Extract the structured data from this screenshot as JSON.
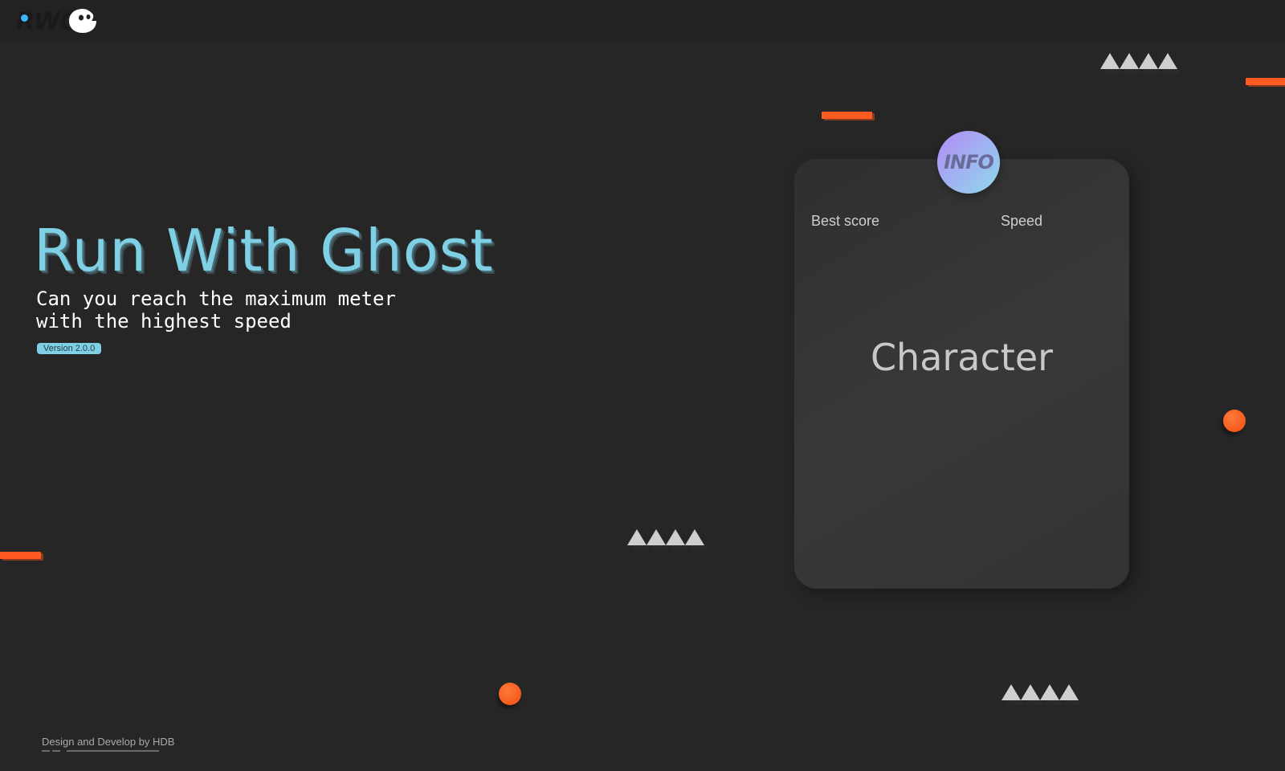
{
  "header": {
    "logo_text": "RWG",
    "logo_icon": "ghost-icon"
  },
  "hero": {
    "title": "Run With Ghost",
    "subtitle": "Can you reach the maximum meter with the highest speed",
    "version": "Version 2.0.0"
  },
  "info_card": {
    "badge": "INFO",
    "best_score_label": "Best score",
    "speed_label": "Speed",
    "character_label": "Character"
  },
  "footer": {
    "credit": "Design and Develop by HDB"
  },
  "colors": {
    "accent": "#7fd0e4",
    "obstacle": "#ff5a1f",
    "spike": "#cfcfcf",
    "background": "#262626"
  }
}
